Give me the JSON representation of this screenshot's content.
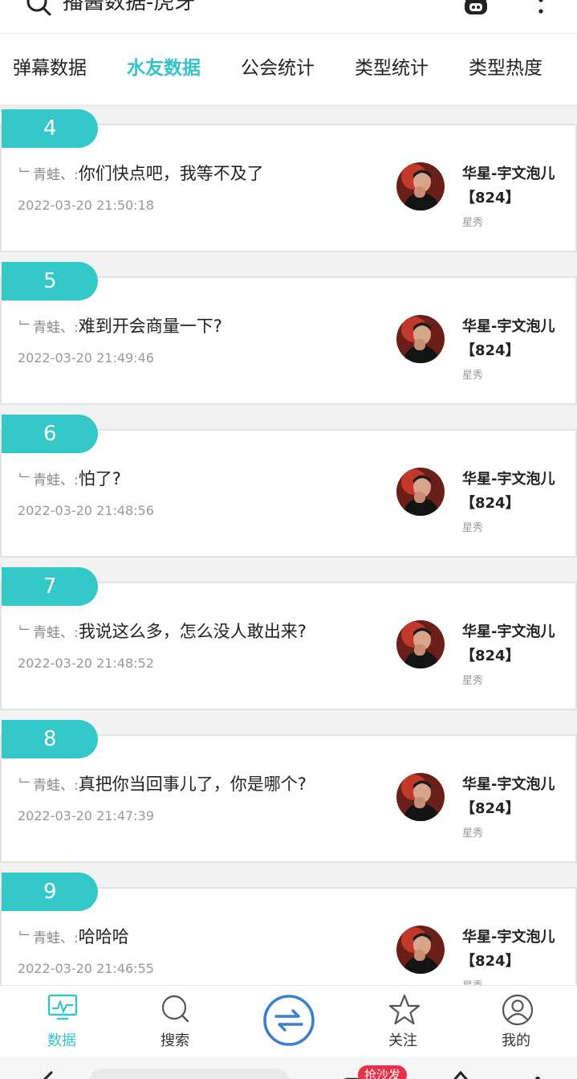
{
  "header": {
    "title": "播酱数据-虎牙",
    "icons": [
      "search-icon",
      "bear-logo-icon",
      "more-icon"
    ]
  },
  "tabs": [
    {
      "label": "弹幕数据",
      "active": false
    },
    {
      "label": "水友数据",
      "active": true
    },
    {
      "label": "公会统计",
      "active": false
    },
    {
      "label": "类型统计",
      "active": false
    },
    {
      "label": "类型热度",
      "active": false
    }
  ],
  "items": [
    {
      "rank": "4",
      "user": "﹂青蛙、:",
      "text": "你们快点吧，我等不及了",
      "time": "2022-03-20 21:50:18",
      "anchor": "华星-宇文泡儿",
      "room": "【824】",
      "category": "星秀"
    },
    {
      "rank": "5",
      "user": "﹂青蛙、:",
      "text": "难到开会商量一下?",
      "time": "2022-03-20 21:49:46",
      "anchor": "华星-宇文泡儿",
      "room": "【824】",
      "category": "星秀"
    },
    {
      "rank": "6",
      "user": "﹂青蛙、:",
      "text": "怕了?",
      "time": "2022-03-20 21:48:56",
      "anchor": "华星-宇文泡儿",
      "room": "【824】",
      "category": "星秀"
    },
    {
      "rank": "7",
      "user": "﹂青蛙、:",
      "text": "我说这么多，怎么没人敢出来?",
      "time": "2022-03-20 21:48:52",
      "anchor": "华星-宇文泡儿",
      "room": "【824】",
      "category": "星秀"
    },
    {
      "rank": "8",
      "user": "﹂青蛙、:",
      "text": "真把你当回事儿了，你是哪个?",
      "time": "2022-03-20 21:47:39",
      "anchor": "华星-宇文泡儿",
      "room": "【824】",
      "category": "星秀"
    },
    {
      "rank": "9",
      "user": "﹂青蛙、:",
      "text": "哈哈哈",
      "time": "2022-03-20 21:46:55",
      "anchor": "华星-宇文泡儿",
      "room": "【824】",
      "category": "星秀"
    }
  ],
  "bottom_nav": {
    "data": "数据",
    "search": "搜索",
    "follow": "关注",
    "mine": "我的"
  },
  "system_bar": {
    "badge": "抢沙发"
  },
  "colors": {
    "accent": "#35c8c9",
    "rank_badge": "#35c8c9",
    "system_badge": "#e8304a",
    "center_button": "#3a7fd0"
  }
}
